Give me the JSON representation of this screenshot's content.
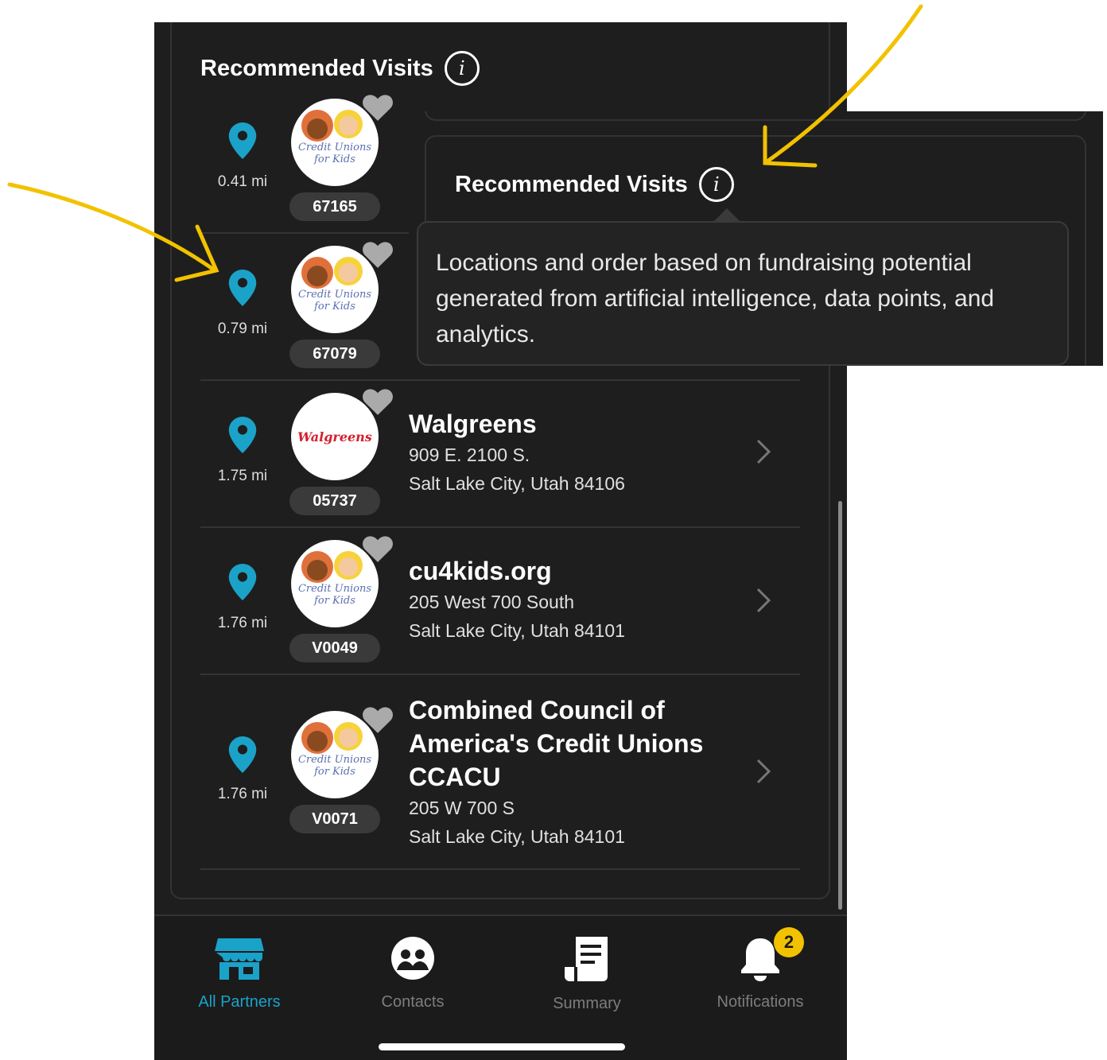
{
  "section": {
    "title": "Recommended Visits"
  },
  "tooltip": {
    "text": "Locations and order based on fundraising potential generated from artificial intelligence, data points, and analytics."
  },
  "logos": {
    "cu4kids": "Credit Unions for Kids",
    "walgreens": "Walgreens"
  },
  "rows": [
    {
      "distance": "0.41 mi",
      "code": "67165",
      "logo": "cu4kids"
    },
    {
      "distance": "0.79 mi",
      "code": "67079",
      "logo": "cu4kids"
    },
    {
      "distance": "1.75 mi",
      "code": "05737",
      "logo": "walgreens",
      "name": "Walgreens",
      "address1": "909 E. 2100 S.",
      "address2": "Salt Lake City, Utah 84106"
    },
    {
      "distance": "1.76 mi",
      "code": "V0049",
      "logo": "cu4kids",
      "name": "cu4kids.org",
      "address1": "205 West 700 South",
      "address2": "Salt Lake City, Utah 84101"
    },
    {
      "distance": "1.76 mi",
      "code": "V0071",
      "logo": "cu4kids",
      "name": "Combined Council of America's Credit Unions CCACU",
      "address1": "205 W 700 S",
      "address2": "Salt Lake City, Utah 84101"
    }
  ],
  "tabs": [
    {
      "label": "All Partners",
      "icon": "store-icon",
      "active": true
    },
    {
      "label": "Contacts",
      "icon": "contacts-icon"
    },
    {
      "label": "Summary",
      "icon": "receipt-icon"
    },
    {
      "label": "Notifications",
      "icon": "bell-icon",
      "badge": "2"
    }
  ],
  "colors": {
    "background": "#1e1e1e",
    "accent": "#1ba2c8",
    "badge": "#f2c200",
    "annotation": "#f2c200"
  }
}
